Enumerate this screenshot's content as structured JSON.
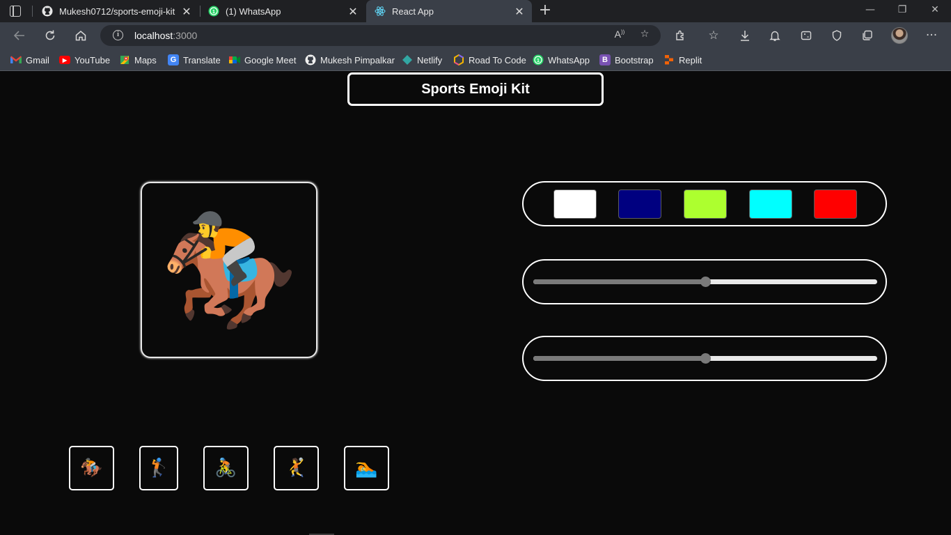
{
  "browser": {
    "tabs": [
      {
        "title": "Mukesh0712/sports-emoji-kit",
        "icon": "github-icon",
        "active": false
      },
      {
        "title": "(1) WhatsApp",
        "icon": "whatsapp-icon",
        "active": false
      },
      {
        "title": "React App",
        "icon": "react-icon",
        "active": true
      }
    ],
    "new_tab_label": "+",
    "address": {
      "host": "localhost",
      "port": ":3000"
    },
    "bookmarks": [
      {
        "label": "Gmail",
        "icon": "gmail-icon"
      },
      {
        "label": "YouTube",
        "icon": "youtube-icon"
      },
      {
        "label": "Maps",
        "icon": "maps-icon"
      },
      {
        "label": "Translate",
        "icon": "translate-icon"
      },
      {
        "label": "Google Meet",
        "icon": "meet-icon"
      },
      {
        "label": "Mukesh Pimpalkar",
        "icon": "github-icon"
      },
      {
        "label": "Netlify",
        "icon": "netlify-icon"
      },
      {
        "label": "Road To Code",
        "icon": "road-to-code-icon"
      },
      {
        "label": "WhatsApp",
        "icon": "whatsapp-icon"
      },
      {
        "label": "Bootstrap",
        "icon": "bootstrap-icon"
      },
      {
        "label": "Replit",
        "icon": "replit-icon"
      }
    ]
  },
  "app": {
    "title": "Sports Emoji Kit",
    "preview_emoji": "🏇",
    "colors": [
      "#ffffff",
      "#000080",
      "#adff2f",
      "#00ffff",
      "#ff0000"
    ],
    "sliders": [
      {
        "name": "size-slider",
        "value": 0.5
      },
      {
        "name": "rotation-slider",
        "value": 0.5
      }
    ],
    "emojis": [
      {
        "name": "horse-racing-emoji",
        "glyph": "🏇"
      },
      {
        "name": "golfer-emoji",
        "glyph": "🏌"
      },
      {
        "name": "cyclist-emoji",
        "glyph": "🚴"
      },
      {
        "name": "handball-emoji",
        "glyph": "🤾"
      },
      {
        "name": "swimmer-emoji",
        "glyph": "🏊"
      }
    ]
  }
}
